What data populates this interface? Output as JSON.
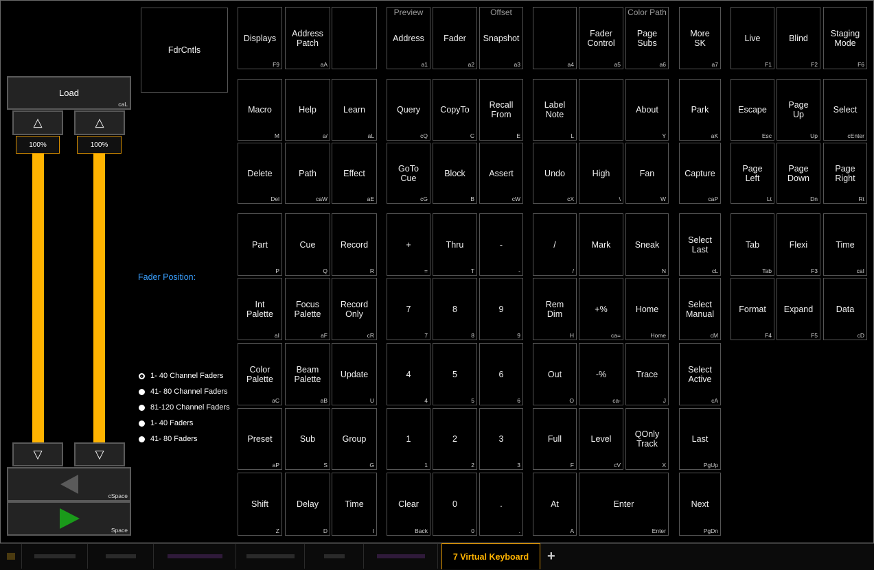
{
  "window": {
    "title": "7 Virtual Keyboard"
  },
  "fader": {
    "fdrcntls_label": "FdrCntls",
    "load": {
      "label": "Load",
      "shortcut": "caL"
    },
    "up_icon": "△",
    "down_icon": "▽",
    "levels": [
      {
        "text": "100%",
        "value": 1.0
      },
      {
        "text": "100%",
        "value": 1.0
      }
    ],
    "back_button": {
      "shortcut": "cSpace",
      "icon": "play-back-icon",
      "color": "#555555"
    },
    "go_button": {
      "shortcut": "Space",
      "icon": "play-go-icon",
      "color": "#1a9a1a"
    },
    "position_label": "Fader Position:",
    "options": [
      "1- 40 Channel Faders",
      "41- 80 Channel Faders",
      "81-120 Channel Faders",
      "1- 40 Faders",
      "41- 80 Faders"
    ],
    "selected_option": "1- 40 Channel Faders"
  },
  "keys": [
    {
      "label": "Displays",
      "shortcut": "F9"
    },
    {
      "label": "Address\nPatch",
      "shortcut": "aA"
    },
    {
      "label": "",
      "shortcut": ""
    },
    {
      "label": "Address",
      "shortcut": "a1",
      "top": "Preview"
    },
    {
      "label": "Fader",
      "shortcut": "a2"
    },
    {
      "label": "Snapshot",
      "shortcut": "a3",
      "top": "Offset"
    },
    {
      "label": "",
      "shortcut": "a4"
    },
    {
      "label": "Fader\nControl",
      "shortcut": "a5"
    },
    {
      "label": "Page\nSubs",
      "shortcut": "a6",
      "top": "Color Path"
    },
    {
      "label": "More\nSK",
      "shortcut": "a7"
    },
    {
      "label": "Live",
      "shortcut": "F1"
    },
    {
      "label": "Blind",
      "shortcut": "F2"
    },
    {
      "label": "Staging\nMode",
      "shortcut": "F6"
    },
    {
      "label": "Macro",
      "shortcut": "M"
    },
    {
      "label": "Help",
      "shortcut": "a/"
    },
    {
      "label": "Learn",
      "shortcut": "aL"
    },
    {
      "label": "Query",
      "shortcut": "cQ"
    },
    {
      "label": "CopyTo",
      "shortcut": "C"
    },
    {
      "label": "Recall\nFrom",
      "shortcut": "E"
    },
    {
      "label": "Label\nNote",
      "shortcut": "L"
    },
    {
      "label": "",
      "shortcut": ""
    },
    {
      "label": "About",
      "shortcut": "Y"
    },
    {
      "label": "Park",
      "shortcut": "aK"
    },
    {
      "label": "Escape",
      "shortcut": "Esc"
    },
    {
      "label": "Page\nUp",
      "shortcut": "Up"
    },
    {
      "label": "Select",
      "shortcut": "cEnter"
    },
    {
      "label": "Delete",
      "shortcut": "Del"
    },
    {
      "label": "Path",
      "shortcut": "caW"
    },
    {
      "label": "Effect",
      "shortcut": "aE"
    },
    {
      "label": "GoTo\nCue",
      "shortcut": "cG"
    },
    {
      "label": "Block",
      "shortcut": "B"
    },
    {
      "label": "Assert",
      "shortcut": "cW"
    },
    {
      "label": "Undo",
      "shortcut": "cX"
    },
    {
      "label": "High",
      "shortcut": "\\"
    },
    {
      "label": "Fan",
      "shortcut": "W"
    },
    {
      "label": "Capture",
      "shortcut": "caP"
    },
    {
      "label": "Page\nLeft",
      "shortcut": "Lt"
    },
    {
      "label": "Page\nDown",
      "shortcut": "Dn"
    },
    {
      "label": "Page\nRight",
      "shortcut": "Rt"
    },
    {
      "label": "Part",
      "shortcut": "P"
    },
    {
      "label": "Cue",
      "shortcut": "Q"
    },
    {
      "label": "Record",
      "shortcut": "R"
    },
    {
      "label": "+",
      "shortcut": "="
    },
    {
      "label": "Thru",
      "shortcut": "T"
    },
    {
      "label": "-",
      "shortcut": "-"
    },
    {
      "label": "/",
      "shortcut": "/"
    },
    {
      "label": "Mark",
      "shortcut": ""
    },
    {
      "label": "Sneak",
      "shortcut": "N"
    },
    {
      "label": "Select\nLast",
      "shortcut": "cL"
    },
    {
      "label": "Tab",
      "shortcut": "Tab"
    },
    {
      "label": "Flexi",
      "shortcut": "F3"
    },
    {
      "label": "Time",
      "shortcut": "caI"
    },
    {
      "label": "Int\nPalette",
      "shortcut": "aI"
    },
    {
      "label": "Focus\nPalette",
      "shortcut": "aF"
    },
    {
      "label": "Record\nOnly",
      "shortcut": "cR"
    },
    {
      "label": "7",
      "shortcut": "7"
    },
    {
      "label": "8",
      "shortcut": "8"
    },
    {
      "label": "9",
      "shortcut": "9"
    },
    {
      "label": "Rem\nDim",
      "shortcut": "H"
    },
    {
      "label": "+%",
      "shortcut": "ca="
    },
    {
      "label": "Home",
      "shortcut": "Home"
    },
    {
      "label": "Select\nManual",
      "shortcut": "cM"
    },
    {
      "label": "Format",
      "shortcut": "F4"
    },
    {
      "label": "Expand",
      "shortcut": "F5"
    },
    {
      "label": "Data",
      "shortcut": "cD"
    },
    {
      "label": "Color\nPalette",
      "shortcut": "aC"
    },
    {
      "label": "Beam\nPalette",
      "shortcut": "aB"
    },
    {
      "label": "Update",
      "shortcut": "U"
    },
    {
      "label": "4",
      "shortcut": "4"
    },
    {
      "label": "5",
      "shortcut": "5"
    },
    {
      "label": "6",
      "shortcut": "6"
    },
    {
      "label": "Out",
      "shortcut": "O"
    },
    {
      "label": "-%",
      "shortcut": "ca-"
    },
    {
      "label": "Trace",
      "shortcut": "J"
    },
    {
      "label": "Select\nActive",
      "shortcut": "cA"
    },
    {
      "label": "Preset",
      "shortcut": "aP"
    },
    {
      "label": "Sub",
      "shortcut": "S"
    },
    {
      "label": "Group",
      "shortcut": "G"
    },
    {
      "label": "1",
      "shortcut": "1"
    },
    {
      "label": "2",
      "shortcut": "2"
    },
    {
      "label": "3",
      "shortcut": "3"
    },
    {
      "label": "Full",
      "shortcut": "F"
    },
    {
      "label": "Level",
      "shortcut": "cV"
    },
    {
      "label": "QOnly\nTrack",
      "shortcut": "X"
    },
    {
      "label": "Last",
      "shortcut": "PgUp"
    },
    {
      "label": "Shift",
      "shortcut": "Z"
    },
    {
      "label": "Delay",
      "shortcut": "D"
    },
    {
      "label": "Time",
      "shortcut": "I"
    },
    {
      "label": "Clear",
      "shortcut": "Back"
    },
    {
      "label": "0",
      "shortcut": "0"
    },
    {
      "label": ".",
      "shortcut": "."
    },
    {
      "label": "At",
      "shortcut": "A"
    },
    {
      "label": "Enter",
      "shortcut": "Enter"
    },
    {
      "label": "Next",
      "shortcut": "PgDn"
    }
  ],
  "tabs": {
    "active": "7 Virtual Keyboard",
    "add": "+"
  },
  "colors": {
    "accent": "#ffb300",
    "link": "#3aa0ff",
    "go": "#1a9a1a"
  }
}
